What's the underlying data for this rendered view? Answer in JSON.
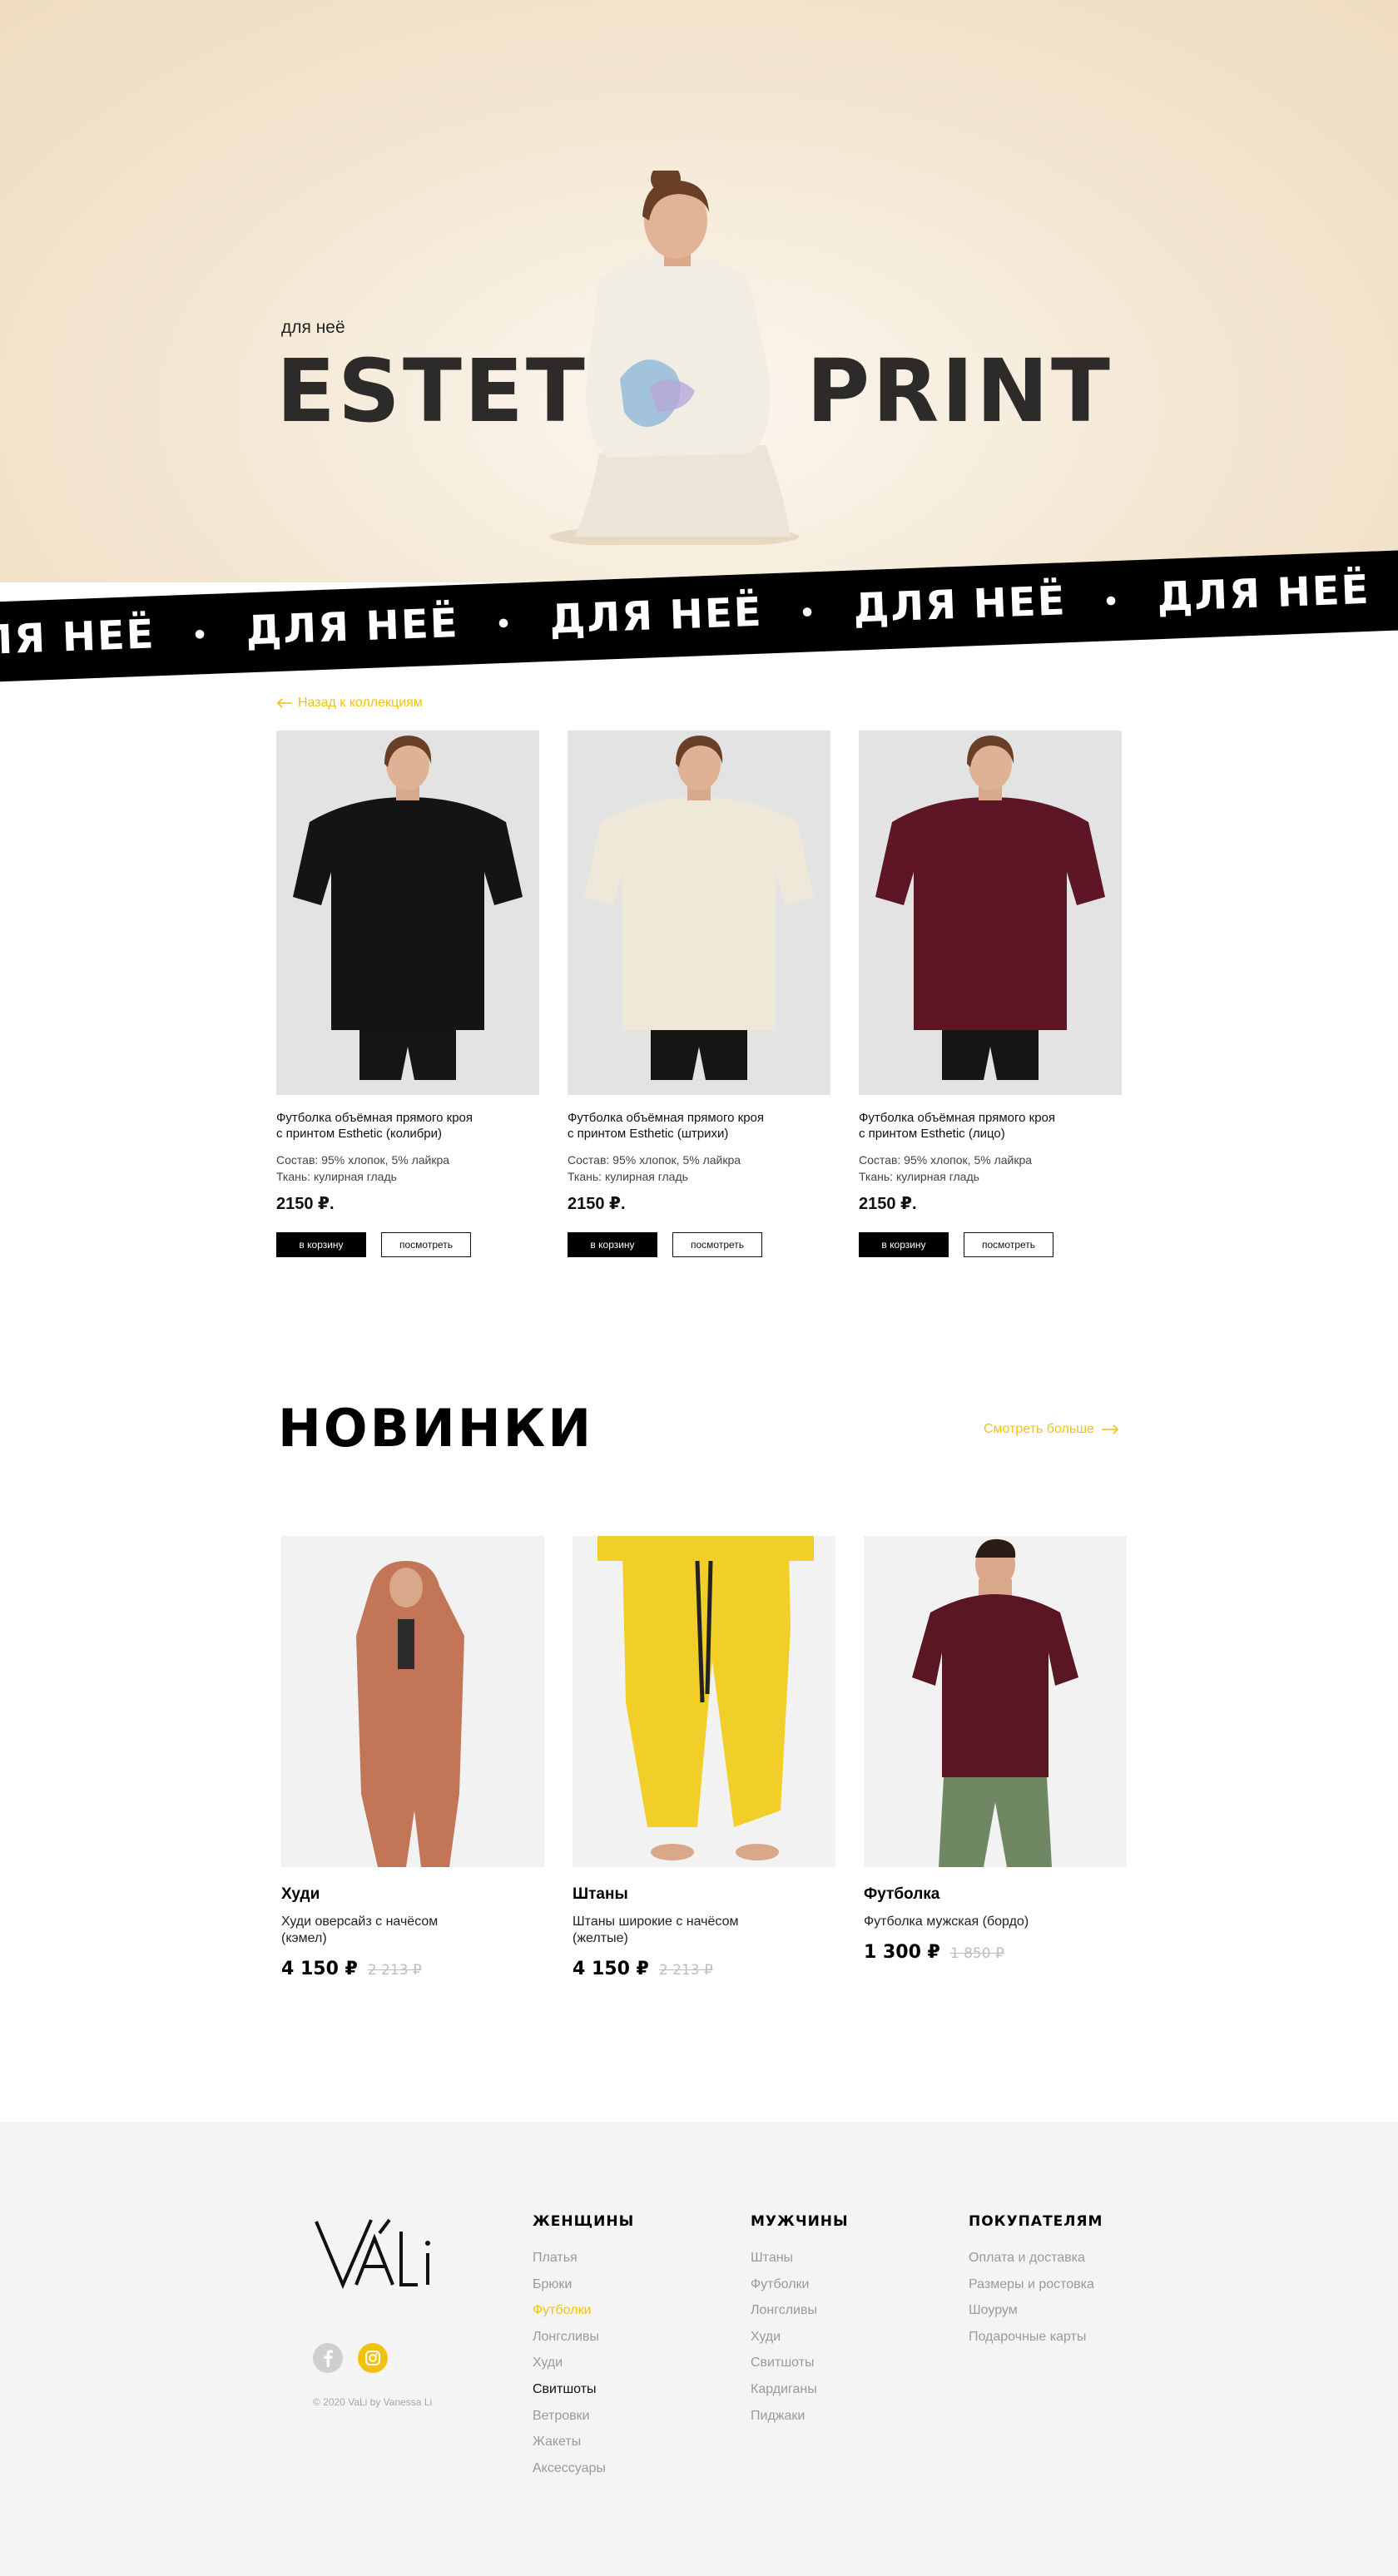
{
  "hero": {
    "subtitle": "для неё",
    "title_part1": "ESTETIC",
    "title_part2": "PRINT"
  },
  "marquee": {
    "text": "ДЛЯ НЕЁ",
    "separator": "•"
  },
  "back_link": {
    "label": "Назад к коллекциям",
    "icon": "arrow-left-icon"
  },
  "products": [
    {
      "name_line1": "Футболка объёмная прямого кроя",
      "name_line2": "с принтом Esthetic (колибри)",
      "composition": "Состав: 95% хлопок, 5% лайкра",
      "fabric": "Ткань: кулирная гладь",
      "price": "2150 ₽.",
      "cart_label": "в корзину",
      "view_label": "посмотреть",
      "shirt_color": "#141414"
    },
    {
      "name_line1": "Футболка объёмная прямого кроя",
      "name_line2": "с принтом Esthetic (штрихи)",
      "composition": "Состав: 95% хлопок, 5% лайкра",
      "fabric": "Ткань: кулирная гладь",
      "price": "2150 ₽.",
      "cart_label": "в корзину",
      "view_label": "посмотреть",
      "shirt_color": "#eee8d8"
    },
    {
      "name_line1": "Футболка объёмная прямого кроя",
      "name_line2": "с принтом Esthetic (лицо)",
      "composition": "Состав: 95% хлопок, 5% лайкра",
      "fabric": "Ткань: кулирная гладь",
      "price": "2150 ₽.",
      "cart_label": "в корзину",
      "view_label": "посмотреть",
      "shirt_color": "#5e1626"
    }
  ],
  "new_section": {
    "title": "НОВИНКИ",
    "see_more": "Смотреть больше",
    "items": [
      {
        "category": "Худи",
        "desc_line1": "Худи оверсайз с начёсом",
        "desc_line2": "(кэмел)",
        "price": "4 150 ₽",
        "old_price": "2 213 ₽",
        "color": "#c27657"
      },
      {
        "category": "Штаны",
        "desc_line1": "Штаны широкие с начёсом",
        "desc_line2": "(желтые)",
        "price": "4 150 ₽",
        "old_price": "2 213 ₽",
        "color": "#f2cf28"
      },
      {
        "category": "Футболка",
        "desc_line1": "Футболка мужская (бордо)",
        "desc_line2": "",
        "price": "1 300 ₽",
        "old_price": "1 850 ₽",
        "color": "#5b1623"
      }
    ]
  },
  "footer": {
    "logo_text": "VÁLi",
    "copyright": "© 2020 VaLi by Vanessa Li",
    "social": [
      "facebook-icon",
      "instagram-icon"
    ],
    "columns": [
      {
        "title": "ЖЕНЩИНЫ",
        "links": [
          "Платья",
          "Брюки",
          "Футболки",
          "Лонгсливы",
          "Худи",
          "Свитшоты",
          "Ветровки",
          "Жакеты",
          "Аксессуары"
        ]
      },
      {
        "title": "МУЖЧИНЫ",
        "links": [
          "Штаны",
          "Футболки",
          "Лонгсливы",
          "Худи",
          "Свитшоты",
          "Кардиганы",
          "Пиджаки"
        ]
      },
      {
        "title": "ПОКУПАТЕЛЯМ",
        "links": [
          "Оплата и доставка",
          "Размеры и ростовка",
          "Шоурум",
          "Подарочные карты"
        ]
      }
    ]
  },
  "colors": {
    "accent": "#f3c20e",
    "dark": "#000000",
    "footer_bg": "#f4f4f4"
  }
}
